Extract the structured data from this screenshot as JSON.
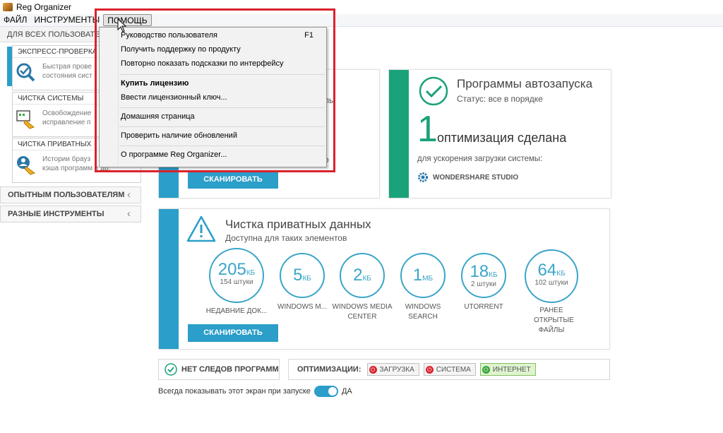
{
  "window": {
    "title": "Reg Organizer"
  },
  "menubar": {
    "items": [
      "ФАЙЛ",
      "ИНСТРУМЕНТЫ",
      "ПОМОЩЬ"
    ]
  },
  "sidebar": {
    "header": "ДЛЯ ВСЕХ ПОЛЬЗОВАТЕЛЕЙ",
    "cards": [
      {
        "caption": "ЭКСПРЕСС-ПРОВЕРКА",
        "line1": "Быстрая прове",
        "line2": "состояния сист"
      },
      {
        "caption": "ЧИСТКА СИСТЕМЫ",
        "line1": "Освобождение",
        "line2": "исправление п"
      },
      {
        "caption": "ЧИСТКА ПРИВАТНЫХ",
        "line1": "Истории брауз",
        "line2": "кэша программ и др."
      }
    ],
    "advanced": "ОПЫТНЫМ ПОЛЬЗОВАТЕЛЯМ",
    "tools": "РАЗНЫЕ ИНСТРУМЕНТЫ"
  },
  "help_menu": {
    "items": [
      {
        "label": "Руководство пользователя",
        "shortcut": "F1"
      },
      {
        "label": "Получить поддержку по продукту"
      },
      {
        "label": "Повторно показать подсказки по интерфейсу"
      },
      {
        "label": "Купить лицензию"
      },
      {
        "label": "Ввести лицензионный ключ..."
      },
      {
        "label": "Домашняя страница"
      },
      {
        "label": "Проверить наличие обновлений"
      },
      {
        "label": "О программе Reg Organizer..."
      }
    ]
  },
  "cleanup_panel": {
    "partial1": "лы",
    "partial2": "о",
    "scan_label": "СКАНИРОВАТЬ"
  },
  "autorun_panel": {
    "title": "Программы автозапуска",
    "status": "Статус: все в порядке",
    "count": "1",
    "done_text": "оптимизация сделана",
    "for_text": "для ускорения загрузки системы:",
    "app": "WONDERSHARE STUDIO",
    "accent_color": "#1aa27a"
  },
  "privacy_panel": {
    "title": "Чистка приватных данных",
    "subtitle": "Доступна для таких элементов",
    "scan_label": "СКАНИРОВАТЬ",
    "items": [
      {
        "num": "205",
        "unit": "КБ",
        "count": "154 штуки",
        "label": "НЕДАВНИЕ ДОК..."
      },
      {
        "num": "5",
        "unit": "КБ",
        "count": "",
        "label": "WINDOWS M..."
      },
      {
        "num": "2",
        "unit": "КБ",
        "count": "",
        "label": "WINDOWS MEDIA CENTER"
      },
      {
        "num": "1",
        "unit": "МБ",
        "count": "",
        "label": "WINDOWS SEARCH"
      },
      {
        "num": "18",
        "unit": "КБ",
        "count": "2 штуки",
        "label": "UTORRENT"
      },
      {
        "num": "64",
        "unit": "КБ",
        "count": "102 штуки",
        "label": "РАНЕЕ ОТКРЫТЫЕ ФАЙЛЫ"
      }
    ]
  },
  "bottom": {
    "no_traces": "НЕТ СЛЕДОВ ПРОГРАММ",
    "optimizations": "ОПТИМИЗАЦИИ:",
    "opt_boot": "ЗАГРУЗКА",
    "opt_system": "СИСТЕМА",
    "opt_internet": "ИНТЕРНЕТ"
  },
  "footer": {
    "text": "Всегда показывать этот экран при запуске",
    "toggle_label": "ДА"
  }
}
